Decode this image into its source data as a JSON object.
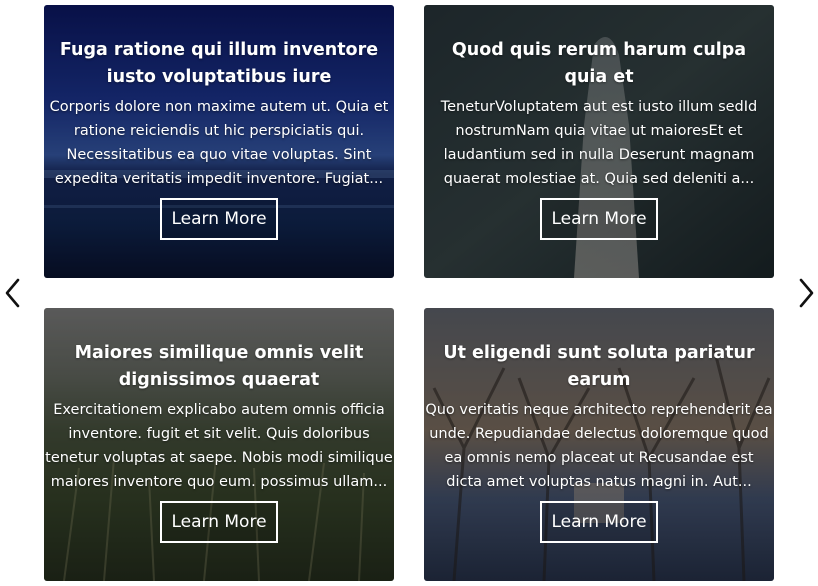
{
  "carousel": {
    "prev_icon": "chevron-left-icon",
    "next_icon": "chevron-right-icon"
  },
  "cards": [
    {
      "title": "Fuga ratione qui illum inventore iusto voluptatibus iure",
      "text": "Corporis dolore non maxime autem ut. Quia et ratione reiciendis ut hic perspiciatis qui. Necessitatibus ea quo vitae voluptas. Sint expedita veritatis impedit inventore. Fugiat...",
      "button": "Learn More",
      "image": "night-lake-scene"
    },
    {
      "title": "Quod quis rerum harum culpa quia et",
      "text": "TeneturVoluptatem aut est iusto illum sedId nostrumNam quia vitae ut maioresEt et laudantium sed in nulla Deserunt magnam quaerat molestiae at. Quia sed deleniti a...",
      "button": "Learn More",
      "image": "figure-dark-scene"
    },
    {
      "title": "Maiores similique omnis velit dignissimos quaerat",
      "text": "Exercitationem explicabo autem omnis officia inventore. fugit et sit velit. Quis doloribus tenetur voluptas at saepe. Nobis modi similique maiores inventore quo eum. possimus ullam...",
      "button": "Learn More",
      "image": "wheat-field"
    },
    {
      "title": "Ut eligendi sunt soluta pariatur earum",
      "text": "Quo veritatis neque architecto reprehenderit ea unde. Repudiandae delectus doloremque quod ea omnis nemo placeat ut Recusandae est dicta amet voluptas natus magni in. Aut...",
      "button": "Learn More",
      "image": "orchard-trees"
    }
  ]
}
